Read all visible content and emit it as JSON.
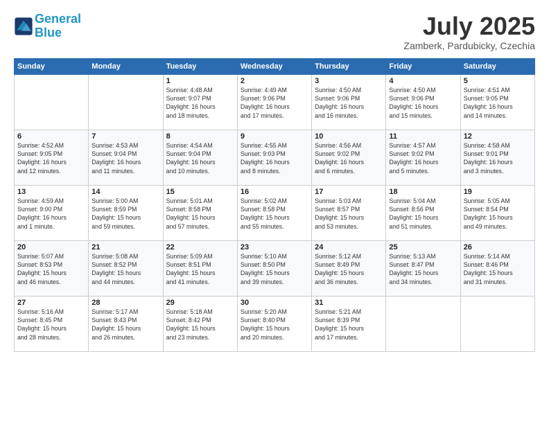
{
  "header": {
    "logo_line1": "General",
    "logo_line2": "Blue",
    "month": "July 2025",
    "location": "Zamberk, Pardubicky, Czechia"
  },
  "days_of_week": [
    "Sunday",
    "Monday",
    "Tuesday",
    "Wednesday",
    "Thursday",
    "Friday",
    "Saturday"
  ],
  "weeks": [
    [
      {
        "day": "",
        "info": ""
      },
      {
        "day": "",
        "info": ""
      },
      {
        "day": "1",
        "info": "Sunrise: 4:48 AM\nSunset: 9:07 PM\nDaylight: 16 hours\nand 18 minutes."
      },
      {
        "day": "2",
        "info": "Sunrise: 4:49 AM\nSunset: 9:06 PM\nDaylight: 16 hours\nand 17 minutes."
      },
      {
        "day": "3",
        "info": "Sunrise: 4:50 AM\nSunset: 9:06 PM\nDaylight: 16 hours\nand 16 minutes."
      },
      {
        "day": "4",
        "info": "Sunrise: 4:50 AM\nSunset: 9:06 PM\nDaylight: 16 hours\nand 15 minutes."
      },
      {
        "day": "5",
        "info": "Sunrise: 4:51 AM\nSunset: 9:05 PM\nDaylight: 16 hours\nand 14 minutes."
      }
    ],
    [
      {
        "day": "6",
        "info": "Sunrise: 4:52 AM\nSunset: 9:05 PM\nDaylight: 16 hours\nand 12 minutes."
      },
      {
        "day": "7",
        "info": "Sunrise: 4:53 AM\nSunset: 9:04 PM\nDaylight: 16 hours\nand 11 minutes."
      },
      {
        "day": "8",
        "info": "Sunrise: 4:54 AM\nSunset: 9:04 PM\nDaylight: 16 hours\nand 10 minutes."
      },
      {
        "day": "9",
        "info": "Sunrise: 4:55 AM\nSunset: 9:03 PM\nDaylight: 16 hours\nand 8 minutes."
      },
      {
        "day": "10",
        "info": "Sunrise: 4:56 AM\nSunset: 9:02 PM\nDaylight: 16 hours\nand 6 minutes."
      },
      {
        "day": "11",
        "info": "Sunrise: 4:57 AM\nSunset: 9:02 PM\nDaylight: 16 hours\nand 5 minutes."
      },
      {
        "day": "12",
        "info": "Sunrise: 4:58 AM\nSunset: 9:01 PM\nDaylight: 16 hours\nand 3 minutes."
      }
    ],
    [
      {
        "day": "13",
        "info": "Sunrise: 4:59 AM\nSunset: 9:00 PM\nDaylight: 16 hours\nand 1 minute."
      },
      {
        "day": "14",
        "info": "Sunrise: 5:00 AM\nSunset: 8:59 PM\nDaylight: 15 hours\nand 59 minutes."
      },
      {
        "day": "15",
        "info": "Sunrise: 5:01 AM\nSunset: 8:58 PM\nDaylight: 15 hours\nand 57 minutes."
      },
      {
        "day": "16",
        "info": "Sunrise: 5:02 AM\nSunset: 8:58 PM\nDaylight: 15 hours\nand 55 minutes."
      },
      {
        "day": "17",
        "info": "Sunrise: 5:03 AM\nSunset: 8:57 PM\nDaylight: 15 hours\nand 53 minutes."
      },
      {
        "day": "18",
        "info": "Sunrise: 5:04 AM\nSunset: 8:56 PM\nDaylight: 15 hours\nand 51 minutes."
      },
      {
        "day": "19",
        "info": "Sunrise: 5:05 AM\nSunset: 8:54 PM\nDaylight: 15 hours\nand 49 minutes."
      }
    ],
    [
      {
        "day": "20",
        "info": "Sunrise: 5:07 AM\nSunset: 8:53 PM\nDaylight: 15 hours\nand 46 minutes."
      },
      {
        "day": "21",
        "info": "Sunrise: 5:08 AM\nSunset: 8:52 PM\nDaylight: 15 hours\nand 44 minutes."
      },
      {
        "day": "22",
        "info": "Sunrise: 5:09 AM\nSunset: 8:51 PM\nDaylight: 15 hours\nand 41 minutes."
      },
      {
        "day": "23",
        "info": "Sunrise: 5:10 AM\nSunset: 8:50 PM\nDaylight: 15 hours\nand 39 minutes."
      },
      {
        "day": "24",
        "info": "Sunrise: 5:12 AM\nSunset: 8:49 PM\nDaylight: 15 hours\nand 36 minutes."
      },
      {
        "day": "25",
        "info": "Sunrise: 5:13 AM\nSunset: 8:47 PM\nDaylight: 15 hours\nand 34 minutes."
      },
      {
        "day": "26",
        "info": "Sunrise: 5:14 AM\nSunset: 8:46 PM\nDaylight: 15 hours\nand 31 minutes."
      }
    ],
    [
      {
        "day": "27",
        "info": "Sunrise: 5:16 AM\nSunset: 8:45 PM\nDaylight: 15 hours\nand 28 minutes."
      },
      {
        "day": "28",
        "info": "Sunrise: 5:17 AM\nSunset: 8:43 PM\nDaylight: 15 hours\nand 26 minutes."
      },
      {
        "day": "29",
        "info": "Sunrise: 5:18 AM\nSunset: 8:42 PM\nDaylight: 15 hours\nand 23 minutes."
      },
      {
        "day": "30",
        "info": "Sunrise: 5:20 AM\nSunset: 8:40 PM\nDaylight: 15 hours\nand 20 minutes."
      },
      {
        "day": "31",
        "info": "Sunrise: 5:21 AM\nSunset: 8:39 PM\nDaylight: 15 hours\nand 17 minutes."
      },
      {
        "day": "",
        "info": ""
      },
      {
        "day": "",
        "info": ""
      }
    ]
  ]
}
